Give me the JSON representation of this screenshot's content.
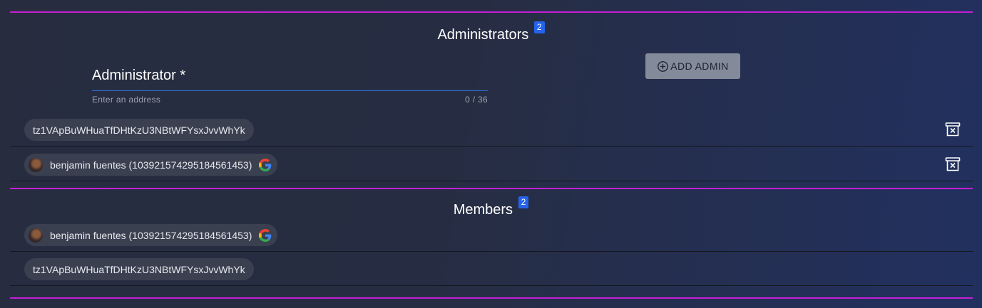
{
  "admins": {
    "title": "Administrators",
    "count": "2",
    "field": {
      "label": "Administrator *",
      "hint": "Enter an address",
      "counter": "0 / 36",
      "value": ""
    },
    "add_button_label": "ADD ADMIN",
    "items": [
      {
        "text": "tz1VApBuWHuaTfDHtKzU3NBtWFYsxJvvWhYk"
      },
      {
        "text": "benjamin fuentes (103921574295184561453)"
      }
    ]
  },
  "members": {
    "title": "Members",
    "count": "2",
    "items": [
      {
        "text": "benjamin fuentes (103921574295184561453)"
      },
      {
        "text": "tz1VApBuWHuaTfDHtKzU3NBtWFYsxJvvWhYk"
      }
    ]
  },
  "icons": {
    "add": "add-circle-icon",
    "delete": "delete-bin-icon",
    "google": "google-icon",
    "avatar": "avatar"
  },
  "colors": {
    "divider": "#c41ed6",
    "badge": "#2563eb",
    "input_underline": "#2f6fd4",
    "chip_bg": "#3a404f",
    "button_bg": "#838a99"
  }
}
